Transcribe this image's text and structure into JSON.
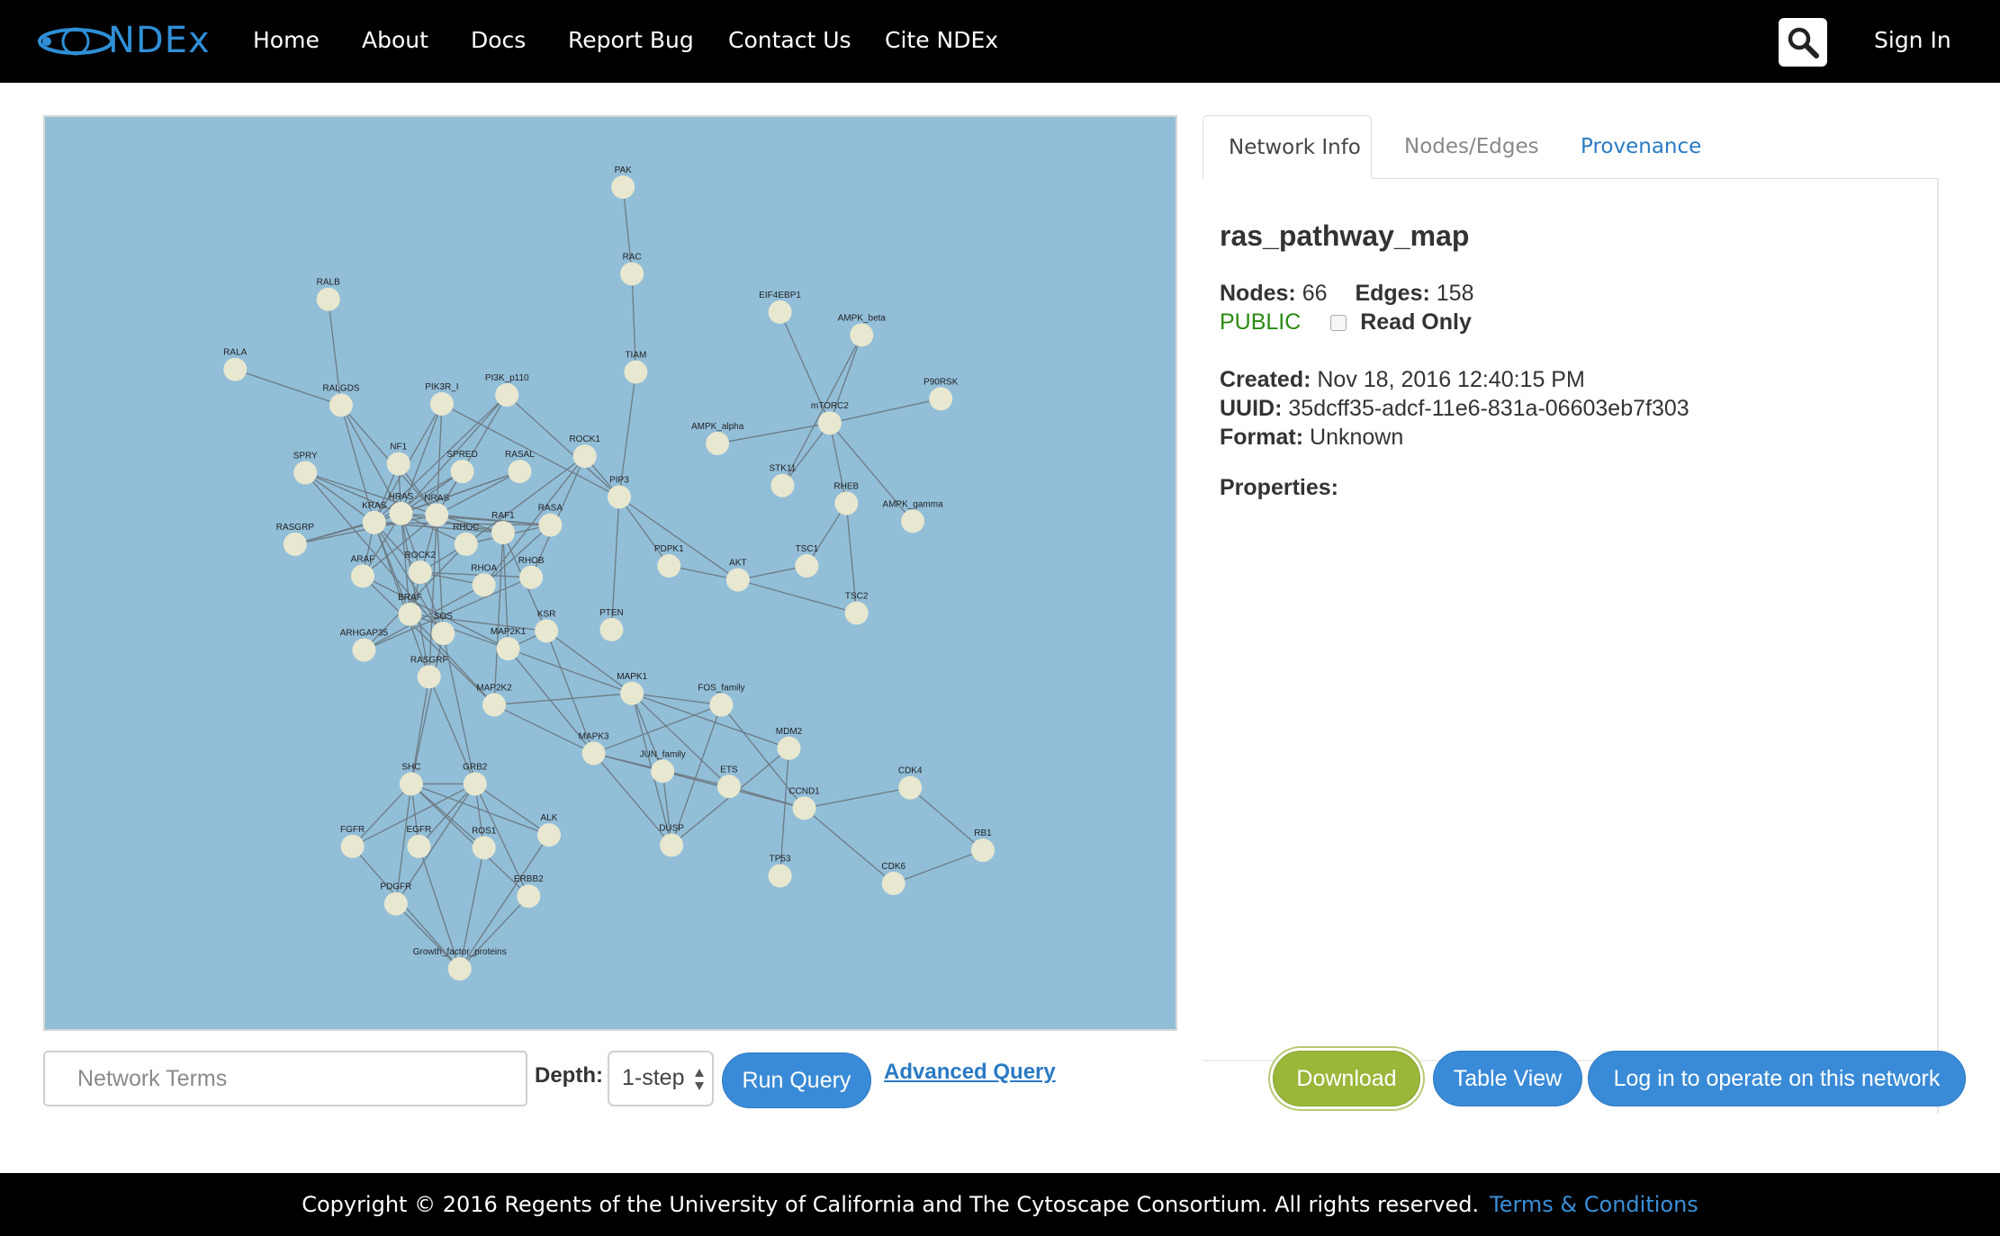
{
  "navbar": {
    "logo_text": "NDEx",
    "items": [
      "Home",
      "About",
      "Docs",
      "Report Bug",
      "Contact Us",
      "Cite NDEx"
    ],
    "sign_in": "Sign In",
    "search_icon": "magnifier-icon"
  },
  "network": {
    "nodes": [
      {
        "id": "PAK",
        "label": "PAK"
      },
      {
        "id": "RAC",
        "label": "RAC"
      },
      {
        "id": "TIAM",
        "label": "TIAM"
      },
      {
        "id": "RALB",
        "label": "RALB"
      },
      {
        "id": "RALA",
        "label": "RALA"
      },
      {
        "id": "RALGDS",
        "label": "RALGDS"
      },
      {
        "id": "PIK3R_I",
        "label": "PIK3R_I"
      },
      {
        "id": "PI3K_p110",
        "label": "PI3K_p110"
      },
      {
        "id": "ROCK1",
        "label": "ROCK1"
      },
      {
        "id": "PIP3",
        "label": "PIP3"
      },
      {
        "id": "SPRY",
        "label": "SPRY"
      },
      {
        "id": "NF1",
        "label": "NF1"
      },
      {
        "id": "SPRED",
        "label": "SPRED"
      },
      {
        "id": "RASAL",
        "label": "RASAL"
      },
      {
        "id": "KRAS",
        "label": "KRAS"
      },
      {
        "id": "HRAS",
        "label": "HRAS"
      },
      {
        "id": "NRAS",
        "label": "NRAS"
      },
      {
        "id": "RHOC",
        "label": "RHOC"
      },
      {
        "id": "RAF1",
        "label": "RAF1"
      },
      {
        "id": "RASA",
        "label": "RASA"
      },
      {
        "id": "RASGRP",
        "label": "RASGRP"
      },
      {
        "id": "ARAF",
        "label": "ARAF"
      },
      {
        "id": "ROCK2",
        "label": "ROCK2"
      },
      {
        "id": "RHOA",
        "label": "RHOA"
      },
      {
        "id": "RHOB",
        "label": "RHOB"
      },
      {
        "id": "BRAF",
        "label": "BRAF"
      },
      {
        "id": "SOS",
        "label": "SOS"
      },
      {
        "id": "ARHGAP35",
        "label": "ARHGAP35"
      },
      {
        "id": "RASGRF",
        "label": "RASGRF"
      },
      {
        "id": "MAP2K1",
        "label": "MAP2K1"
      },
      {
        "id": "KSR",
        "label": "KSR"
      },
      {
        "id": "PTEN",
        "label": "PTEN"
      },
      {
        "id": "PDPK1",
        "label": "PDPK1"
      },
      {
        "id": "AKT",
        "label": "AKT"
      },
      {
        "id": "TSC1",
        "label": "TSC1"
      },
      {
        "id": "TSC2",
        "label": "TSC2"
      },
      {
        "id": "EIF4EBP1",
        "label": "EIF4EBP1"
      },
      {
        "id": "AMPK_beta",
        "label": "AMPK_beta"
      },
      {
        "id": "P90RSK",
        "label": "P90RSK"
      },
      {
        "id": "mTORC2",
        "label": "mTORC2"
      },
      {
        "id": "AMPK_alpha",
        "label": "AMPK_alpha"
      },
      {
        "id": "STK11",
        "label": "STK11"
      },
      {
        "id": "RHEB",
        "label": "RHEB"
      },
      {
        "id": "AMPK_gamma",
        "label": "AMPK_gamma"
      },
      {
        "id": "MAP2K2",
        "label": "MAP2K2"
      },
      {
        "id": "MAPK1",
        "label": "MAPK1"
      },
      {
        "id": "FOS_family",
        "label": "FOS_family"
      },
      {
        "id": "MAPK3",
        "label": "MAPK3"
      },
      {
        "id": "MDM2",
        "label": "MDM2"
      },
      {
        "id": "JUN_family",
        "label": "JUN_family"
      },
      {
        "id": "ETS",
        "label": "ETS"
      },
      {
        "id": "CCND1",
        "label": "CCND1"
      },
      {
        "id": "CDK4",
        "label": "CDK4"
      },
      {
        "id": "RB1",
        "label": "RB1"
      },
      {
        "id": "DUSP",
        "label": "DUSP"
      },
      {
        "id": "TP53",
        "label": "TP53"
      },
      {
        "id": "CDK6",
        "label": "CDK6"
      },
      {
        "id": "SHC",
        "label": "SHC"
      },
      {
        "id": "GRB2",
        "label": "GRB2"
      },
      {
        "id": "ALK",
        "label": "ALK"
      },
      {
        "id": "FGFR",
        "label": "FGFR"
      },
      {
        "id": "EGFR",
        "label": "EGFR"
      },
      {
        "id": "ROS1",
        "label": "ROS1"
      },
      {
        "id": "ERBB2",
        "label": "ERBB2"
      },
      {
        "id": "PDGFR",
        "label": "PDGFR"
      },
      {
        "id": "Growth_factor_proteins",
        "label": "Growth_factor_proteins"
      }
    ],
    "colors": {
      "background": "#92bed8",
      "node": "#e8e7cf",
      "edge": "#6e7b83"
    }
  },
  "info": {
    "tabs": [
      "Network Info",
      "Nodes/Edges",
      "Provenance"
    ],
    "title": "ras_pathway_map",
    "nodes_label": "Nodes:",
    "nodes_value": "66",
    "edges_label": "Edges:",
    "edges_value": "158",
    "visibility": "PUBLIC",
    "read_only_label": "Read Only",
    "read_only_checked": false,
    "created_label": "Created:",
    "created_value": "Nov 18, 2016 12:40:15 PM",
    "uuid_label": "UUID:",
    "uuid_value": "35dcff35-adcf-11e6-831a-06603eb7f303",
    "format_label": "Format:",
    "format_value": "Unknown",
    "properties_label": "Properties:"
  },
  "query": {
    "terms_placeholder": "Network Terms",
    "depth_label": "Depth:",
    "depth_value": "1-step",
    "run_label": "Run Query",
    "advanced_label": "Advanced Query"
  },
  "actions": {
    "download": "Download",
    "table_view": "Table View",
    "login_operate": "Log in to operate on this network"
  },
  "footer": {
    "copyright": "Copyright © 2016 Regents of the University of California and The Cytoscape Consortium. All rights reserved.",
    "terms_link": "Terms & Conditions"
  }
}
